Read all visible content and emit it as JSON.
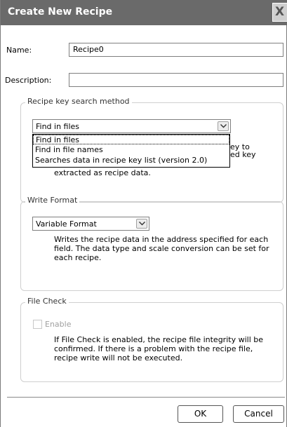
{
  "window": {
    "title": "Create New Recipe",
    "close_label": "X"
  },
  "name_field": {
    "label": "Name:",
    "value": "Recipe0"
  },
  "description_field": {
    "label": "Description:",
    "value": ""
  },
  "recipe_key_group": {
    "legend": "Recipe key search method",
    "selected": "Find in files",
    "options": [
      "Find in files",
      "Find in file names",
      "Searches data in recipe key list (version 2.0)"
    ],
    "desc_fragments": [
      "ey to",
      "ed key",
      "extracted as recipe data."
    ]
  },
  "write_format_group": {
    "legend": "Write Format",
    "selected": "Variable Format",
    "description": "Writes the recipe data in the address specified for each field. The data type and scale conversion can be set for each recipe."
  },
  "file_check_group": {
    "legend": "File Check",
    "checkbox_label": "Enable",
    "checked": false,
    "description": "If File Check is enabled, the recipe file integrity will be confirmed. If there is a problem with the recipe file, recipe write will not be executed."
  },
  "buttons": {
    "ok": "OK",
    "cancel": "Cancel"
  }
}
